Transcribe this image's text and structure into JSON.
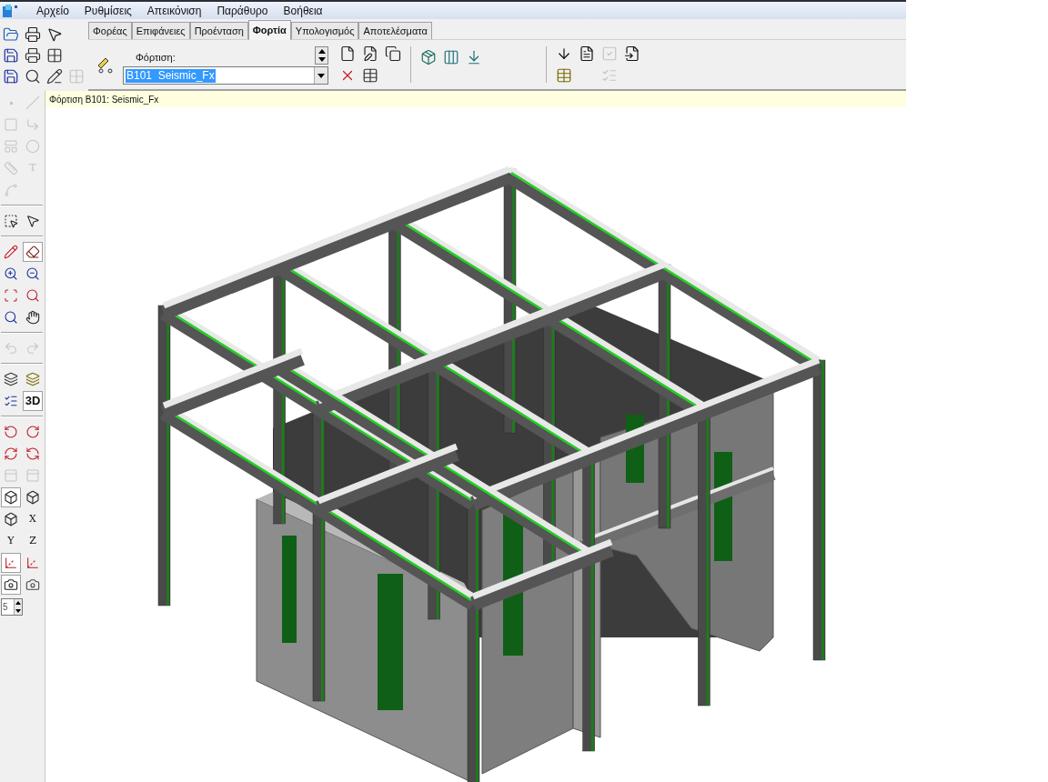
{
  "menu": [
    "Αρχείο",
    "Ρυθμίσεις",
    "Απεικόνιση",
    "Παράθυρο",
    "Βοήθεια"
  ],
  "quick_tools": [
    [
      {
        "kind": "open",
        "disabled": false
      },
      {
        "kind": "print",
        "disabled": false
      },
      {
        "kind": "pointer",
        "disabled": false
      }
    ],
    [
      {
        "kind": "save",
        "disabled": false
      },
      {
        "kind": "print-setup",
        "disabled": false
      },
      {
        "kind": "grid",
        "disabled": false
      }
    ],
    [
      {
        "kind": "save",
        "disabled": false
      },
      {
        "kind": "preview",
        "disabled": false
      },
      {
        "kind": "grid-edit",
        "disabled": false
      },
      {
        "kind": "grid",
        "disabled": true
      }
    ]
  ],
  "tabs": [
    {
      "label": "Φορέας",
      "selected": false
    },
    {
      "label": "Επιφάνειες",
      "selected": false
    },
    {
      "label": "Προένταση",
      "selected": false
    },
    {
      "label": "Φορτία",
      "selected": true
    },
    {
      "label": "Υπολογισμός",
      "selected": false
    },
    {
      "label": "Αποτελέσματα",
      "selected": false
    }
  ],
  "load": {
    "label": "Φόρτιση:",
    "value": "B101  Seismic_Fx"
  },
  "load_tools": [
    [
      {
        "kind": "new",
        "disabled": false
      },
      {
        "kind": "edit",
        "disabled": false
      },
      {
        "kind": "copy",
        "disabled": false
      }
    ],
    [
      {
        "kind": "delete",
        "disabled": false
      },
      {
        "kind": "table",
        "disabled": false
      }
    ]
  ],
  "analysis_tools": [
    {
      "kind": "factor",
      "disabled": false
    },
    {
      "kind": "bars",
      "disabled": false
    },
    {
      "kind": "apply",
      "disabled": false
    }
  ],
  "result_tools": [
    [
      {
        "kind": "arrows",
        "disabled": false
      },
      {
        "kind": "document",
        "disabled": false
      },
      {
        "kind": "check",
        "disabled": true
      },
      {
        "kind": "report",
        "disabled": false
      }
    ],
    [
      {
        "kind": "table-edit",
        "disabled": false
      },
      {
        "kind": "check-all",
        "disabled": true
      }
    ]
  ],
  "status": "Φόρτιση B101: Seismic_Fx",
  "side_tools": [
    [
      {
        "kind": "point",
        "pressed": false,
        "disabled": true
      },
      {
        "kind": "line",
        "pressed": false,
        "disabled": true
      }
    ],
    [
      {
        "kind": "rect",
        "pressed": false,
        "disabled": true
      },
      {
        "kind": "angle",
        "pressed": false,
        "disabled": true
      }
    ],
    [
      {
        "kind": "polyline",
        "pressed": false,
        "disabled": true
      },
      {
        "kind": "circle",
        "pressed": false,
        "disabled": true
      }
    ],
    [
      {
        "kind": "dimension",
        "pressed": false,
        "disabled": true
      },
      {
        "kind": "letter",
        "label": "T",
        "pressed": false,
        "disabled": true
      }
    ],
    [
      {
        "kind": "curve",
        "pressed": false,
        "disabled": true
      }
    ],
    [
      {
        "kind": "separator"
      }
    ],
    [
      {
        "kind": "node-select",
        "pressed": false,
        "disabled": false
      },
      {
        "kind": "pointer",
        "pressed": false,
        "disabled": false
      }
    ],
    [
      {
        "kind": "separator"
      }
    ],
    [
      {
        "kind": "pencil",
        "pressed": false,
        "disabled": false
      },
      {
        "kind": "eraser",
        "pressed": true,
        "disabled": false
      }
    ],
    [
      {
        "kind": "zoom-in",
        "pressed": false,
        "disabled": false
      },
      {
        "kind": "zoom-out",
        "pressed": false,
        "disabled": false
      }
    ],
    [
      {
        "kind": "zoom-window",
        "pressed": false,
        "disabled": false
      },
      {
        "kind": "zoom-previous",
        "pressed": false,
        "disabled": false
      }
    ],
    [
      {
        "kind": "zoom-extents",
        "pressed": false,
        "disabled": false
      },
      {
        "kind": "pan",
        "pressed": false,
        "disabled": false
      }
    ],
    [
      {
        "kind": "separator"
      }
    ],
    [
      {
        "kind": "undo",
        "pressed": false,
        "disabled": true
      },
      {
        "kind": "redo",
        "pressed": false,
        "disabled": true
      }
    ],
    [
      {
        "kind": "separator"
      }
    ],
    [
      {
        "kind": "plane",
        "pressed": false,
        "disabled": false
      },
      {
        "kind": "plane-edit",
        "pressed": false,
        "disabled": false
      }
    ],
    [
      {
        "kind": "checklist",
        "pressed": false,
        "disabled": false
      },
      {
        "kind": "letter",
        "label": "3D",
        "pressed": true,
        "disabled": false
      }
    ],
    [
      {
        "kind": "separator"
      }
    ],
    [
      {
        "kind": "rotate-left",
        "pressed": false,
        "disabled": false
      },
      {
        "kind": "rotate-right",
        "pressed": false,
        "disabled": false
      }
    ],
    [
      {
        "kind": "rotate-up",
        "pressed": false,
        "disabled": false
      },
      {
        "kind": "rotate-down",
        "pressed": false,
        "disabled": false
      }
    ],
    [
      {
        "kind": "frames",
        "pressed": false,
        "disabled": true
      },
      {
        "kind": "frames",
        "pressed": false,
        "disabled": true
      }
    ],
    [
      {
        "kind": "cube",
        "pressed": true,
        "disabled": false
      },
      {
        "kind": "cube",
        "pressed": false,
        "disabled": false
      }
    ],
    [
      {
        "kind": "cube-top",
        "pressed": false,
        "disabled": false
      },
      {
        "kind": "letter",
        "label": "X",
        "pressed": false,
        "disabled": false
      }
    ],
    [
      {
        "kind": "letter",
        "label": "Y",
        "pressed": false,
        "disabled": false
      },
      {
        "kind": "letter",
        "label": "Z",
        "pressed": false,
        "disabled": false
      }
    ],
    [
      {
        "kind": "axes",
        "pressed": true,
        "disabled": false
      },
      {
        "kind": "axes-edit",
        "pressed": false,
        "disabled": false
      }
    ],
    [
      {
        "kind": "camera",
        "pressed": true,
        "disabled": false
      },
      {
        "kind": "camera-edit",
        "pressed": false,
        "disabled": false
      }
    ]
  ],
  "spinner": {
    "value": "5"
  }
}
